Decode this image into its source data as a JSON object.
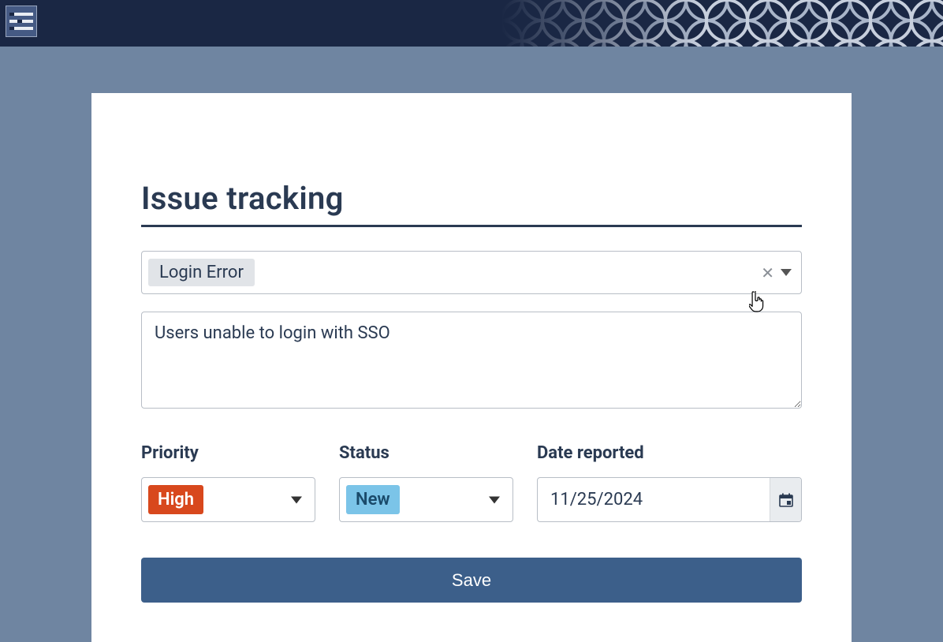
{
  "header": {
    "menu_icon": "menu-icon"
  },
  "form": {
    "title": "Issue tracking",
    "category": {
      "selected": "Login Error"
    },
    "description": "Users unable to login with SSO",
    "fields": {
      "priority": {
        "label": "Priority",
        "value": "High",
        "color": "#d8481d"
      },
      "status": {
        "label": "Status",
        "value": "New",
        "color": "#7bc4e8"
      },
      "date_reported": {
        "label": "Date reported",
        "value": "11/25/2024"
      }
    },
    "save_label": "Save"
  }
}
